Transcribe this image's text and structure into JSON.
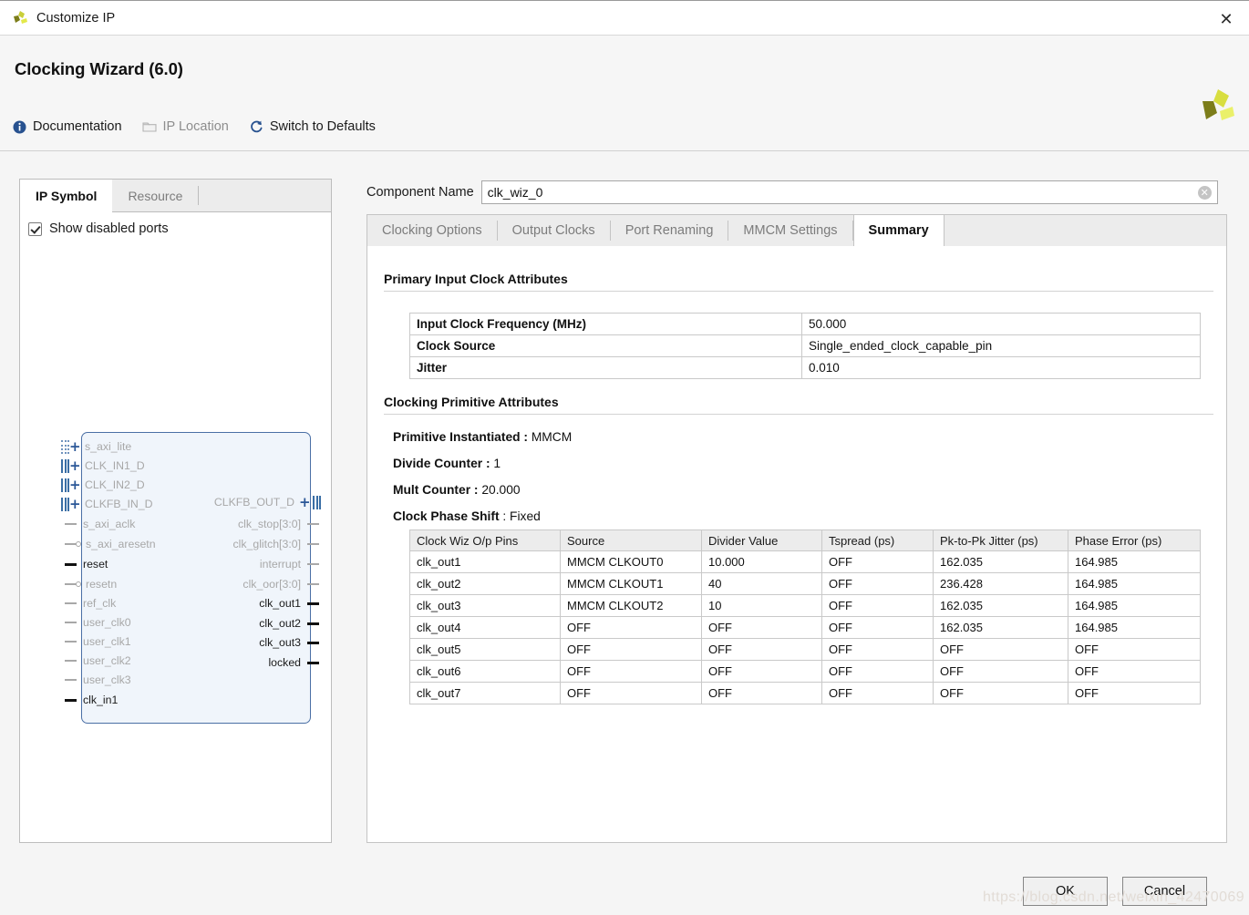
{
  "window": {
    "title": "Customize IP",
    "close_icon": "close-icon",
    "app_icon": "xilinx-logo-icon"
  },
  "header": {
    "title": "Clocking Wizard (6.0)",
    "logo_icon": "xilinx-logo",
    "toolbar": [
      {
        "label": "Documentation",
        "icon": "info-icon",
        "disabled": false
      },
      {
        "label": "IP Location",
        "icon": "folder-icon",
        "disabled": true
      },
      {
        "label": "Switch to Defaults",
        "icon": "refresh-icon",
        "disabled": false
      }
    ]
  },
  "left_panel": {
    "tabs": [
      {
        "label": "IP Symbol",
        "active": true
      },
      {
        "label": "Resource",
        "active": false
      }
    ],
    "show_disabled_ports": {
      "label": "Show disabled ports",
      "checked": true
    },
    "symbol": {
      "inputs": [
        {
          "name": "s_axi_lite",
          "kind": "bus",
          "enabled": false,
          "conn": "dotted"
        },
        {
          "name": "CLK_IN1_D",
          "kind": "bus",
          "enabled": false,
          "conn": "solid"
        },
        {
          "name": "CLK_IN2_D",
          "kind": "bus",
          "enabled": false,
          "conn": "solid"
        },
        {
          "name": "CLKFB_IN_D",
          "kind": "bus",
          "enabled": false,
          "conn": "solid"
        },
        {
          "name": "s_axi_aclk",
          "kind": "pin",
          "enabled": false,
          "bubble": false
        },
        {
          "name": "s_axi_aresetn",
          "kind": "pin",
          "enabled": false,
          "bubble": true
        },
        {
          "name": "reset",
          "kind": "pin",
          "enabled": true,
          "bubble": false
        },
        {
          "name": "resetn",
          "kind": "pin",
          "enabled": false,
          "bubble": true
        },
        {
          "name": "ref_clk",
          "kind": "pin",
          "enabled": false,
          "bubble": false
        },
        {
          "name": "user_clk0",
          "kind": "pin",
          "enabled": false,
          "bubble": false
        },
        {
          "name": "user_clk1",
          "kind": "pin",
          "enabled": false,
          "bubble": false
        },
        {
          "name": "user_clk2",
          "kind": "pin",
          "enabled": false,
          "bubble": false
        },
        {
          "name": "user_clk3",
          "kind": "pin",
          "enabled": false,
          "bubble": false
        },
        {
          "name": "clk_in1",
          "kind": "pin",
          "enabled": true,
          "bubble": false
        }
      ],
      "outputs": [
        {
          "name": "CLKFB_OUT_D",
          "kind": "bus",
          "enabled": false
        },
        {
          "name": "clk_stop[3:0]",
          "kind": "pin",
          "enabled": false
        },
        {
          "name": "clk_glitch[3:0]",
          "kind": "pin",
          "enabled": false
        },
        {
          "name": "interrupt",
          "kind": "pin",
          "enabled": false
        },
        {
          "name": "clk_oor[3:0]",
          "kind": "pin",
          "enabled": false
        },
        {
          "name": "clk_out1",
          "kind": "pin",
          "enabled": true
        },
        {
          "name": "clk_out2",
          "kind": "pin",
          "enabled": true
        },
        {
          "name": "clk_out3",
          "kind": "pin",
          "enabled": true
        },
        {
          "name": "locked",
          "kind": "pin",
          "enabled": true
        }
      ]
    }
  },
  "component": {
    "label": "Component Name",
    "value": "clk_wiz_0",
    "clear_icon": "clear-circle-icon"
  },
  "tabs": [
    {
      "label": "Clocking Options",
      "active": false
    },
    {
      "label": "Output Clocks",
      "active": false
    },
    {
      "label": "Port Renaming",
      "active": false
    },
    {
      "label": "MMCM Settings",
      "active": false
    },
    {
      "label": "Summary",
      "active": true
    }
  ],
  "summary": {
    "primary_input": {
      "title": "Primary Input Clock Attributes",
      "rows": [
        {
          "key": "Input Clock Frequency (MHz)",
          "value": "50.000"
        },
        {
          "key": "Clock Source",
          "value": "Single_ended_clock_capable_pin"
        },
        {
          "key": "Jitter",
          "value": "0.010"
        }
      ]
    },
    "primitive": {
      "title": "Clocking Primitive Attributes",
      "facts": [
        {
          "key": "Primitive Instantiated :",
          "value": "MMCM"
        },
        {
          "key": "Divide Counter :",
          "value": "1"
        },
        {
          "key": "Mult Counter :",
          "value": "20.000"
        },
        {
          "key": "Clock Phase Shift",
          "value": ": Fixed"
        }
      ],
      "table": {
        "columns": [
          "Clock Wiz O/p Pins",
          "Source",
          "Divider Value",
          "Tspread (ps)",
          "Pk-to-Pk Jitter (ps)",
          "Phase Error (ps)"
        ],
        "rows": [
          [
            "clk_out1",
            "MMCM CLKOUT0",
            "10.000",
            "OFF",
            "162.035",
            "164.985"
          ],
          [
            "clk_out2",
            "MMCM CLKOUT1",
            "40",
            "OFF",
            "236.428",
            "164.985"
          ],
          [
            "clk_out3",
            "MMCM CLKOUT2",
            "10",
            "OFF",
            "162.035",
            "164.985"
          ],
          [
            "clk_out4",
            "OFF",
            "OFF",
            "OFF",
            "162.035",
            "164.985"
          ],
          [
            "clk_out5",
            "OFF",
            "OFF",
            "OFF",
            "OFF",
            "OFF"
          ],
          [
            "clk_out6",
            "OFF",
            "OFF",
            "OFF",
            "OFF",
            "OFF"
          ],
          [
            "clk_out7",
            "OFF",
            "OFF",
            "OFF",
            "OFF",
            "OFF"
          ]
        ]
      }
    }
  },
  "footer": {
    "ok_label": "OK",
    "cancel_label": "Cancel"
  },
  "watermark": "https://blog.csdn.net/weixin_42470069",
  "colors": {
    "accent_blue": "#2b5797",
    "symbol_fill": "#f0f5fb",
    "symbol_border": "#4a6fa5",
    "xilinx_light": "#e3e84a",
    "xilinx_dark": "#7c7d1a"
  }
}
